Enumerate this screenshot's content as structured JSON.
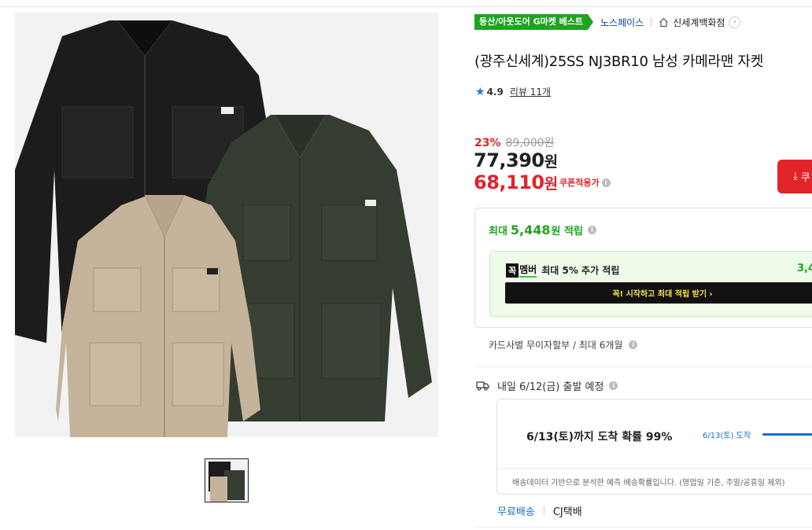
{
  "gallery": {
    "main_image_alt": "",
    "thumbnail_count": 1
  },
  "badges": {
    "best_label": "등산/아웃도어 G마켓 베스트",
    "brand": "노스페이스",
    "store": "신세계백화점"
  },
  "product": {
    "title": "(광주신세계)25SS NJ3BR10 남성 카메라맨 자켓",
    "rating": "4.9",
    "review_label": "리뷰 11개",
    "discount_rate": "23%",
    "original_price": "89,000원",
    "price_number": "77,390",
    "price_unit": "원",
    "coupon_price_number": "68,110",
    "coupon_price_unit": "원",
    "coupon_label": "쿠폰적용가",
    "download_label": "쿠"
  },
  "points": {
    "prefix": "최대",
    "amount": "5,448",
    "suffix": "원 적립",
    "member_logo_k": "꼭",
    "member_logo_m": "멤버",
    "member_text": "최대 5% 추가 적립",
    "member_amount": "3,4",
    "member_button": "꼭! 시작하고 최대 적립 받기  ›"
  },
  "installment": "카드사별 무이자할부 / 최대 6개월",
  "shipping": {
    "dispatch": "내일 6/12(금) 출발 예정",
    "arrival": "6/13(토)까지 도착 확률 99%",
    "arrival_date": "6/13(토) 도착",
    "note": "배송데이터 기반으로 분석한 예측 배송확률입니다. (영업일 기준, 주말/공휴일 제외)",
    "free": "무료배송",
    "carrier": "CJ택배"
  },
  "colors": {
    "accent_red": "#e2232a",
    "green": "#1fa31f",
    "blue": "#1a73e8"
  }
}
